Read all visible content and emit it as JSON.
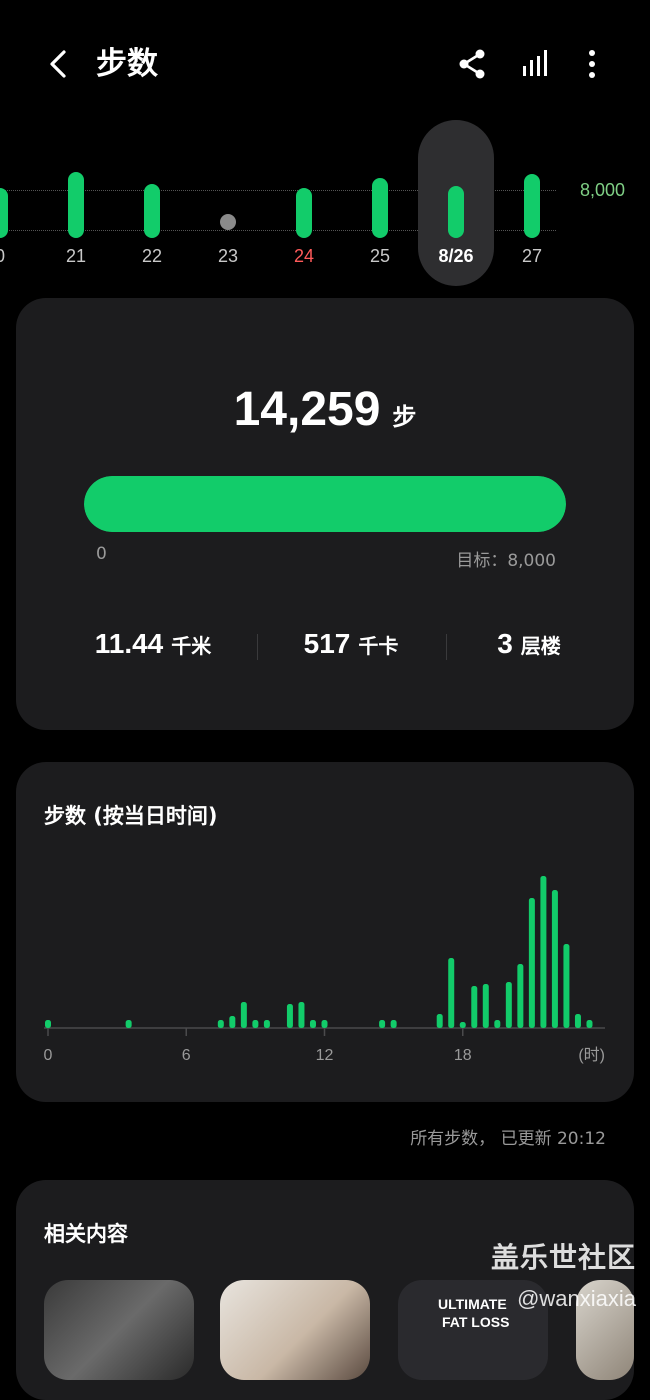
{
  "header": {
    "title": "步数",
    "icons": [
      "back-arrow-icon",
      "share-icon",
      "bar-chart-icon",
      "more-vertical-icon"
    ]
  },
  "daystrip": {
    "goal_label": "8,000",
    "days": [
      {
        "label": "0",
        "steps_fraction": 0.85,
        "state": "normal"
      },
      {
        "label": "21",
        "steps_fraction": 1.25,
        "state": "normal"
      },
      {
        "label": "22",
        "steps_fraction": 0.95,
        "state": "normal"
      },
      {
        "label": "23",
        "steps_fraction": 0,
        "state": "empty"
      },
      {
        "label": "24",
        "steps_fraction": 0.85,
        "state": "weekend"
      },
      {
        "label": "25",
        "steps_fraction": 1.1,
        "state": "normal"
      },
      {
        "label": "8/26",
        "steps_fraction": 0.9,
        "state": "selected"
      },
      {
        "label": "27",
        "steps_fraction": 1.2,
        "state": "normal"
      }
    ]
  },
  "summary": {
    "steps": "14,259",
    "steps_unit": "步",
    "progress_fraction": 1.0,
    "progress_min": "0",
    "goal_text": "目标：8,000",
    "stats": [
      {
        "value": "11.44",
        "unit": "千米"
      },
      {
        "value": "517",
        "unit": "千卡"
      },
      {
        "value": "3",
        "unit": "层楼"
      }
    ]
  },
  "hourly": {
    "title": "步数 (按当日时间)"
  },
  "chart_data": {
    "type": "bar",
    "title": "步数 (按当日时间)",
    "x_tick_labels": [
      "0",
      "6",
      "12",
      "18",
      "(时)"
    ],
    "x_ticks": [
      0,
      6,
      12,
      18
    ],
    "xlim": [
      0,
      24
    ],
    "unit": "(时)",
    "bars": [
      {
        "x": 0.0,
        "v": 8
      },
      {
        "x": 3.5,
        "v": 8
      },
      {
        "x": 7.5,
        "v": 8
      },
      {
        "x": 8.0,
        "v": 12
      },
      {
        "x": 8.5,
        "v": 26
      },
      {
        "x": 9.0,
        "v": 8
      },
      {
        "x": 9.5,
        "v": 8
      },
      {
        "x": 10.5,
        "v": 24
      },
      {
        "x": 11.0,
        "v": 26
      },
      {
        "x": 11.5,
        "v": 8
      },
      {
        "x": 12.0,
        "v": 8
      },
      {
        "x": 14.5,
        "v": 8
      },
      {
        "x": 15.0,
        "v": 8
      },
      {
        "x": 17.0,
        "v": 14
      },
      {
        "x": 17.5,
        "v": 70
      },
      {
        "x": 18.0,
        "v": 6
      },
      {
        "x": 18.5,
        "v": 42
      },
      {
        "x": 19.0,
        "v": 44
      },
      {
        "x": 19.5,
        "v": 8
      },
      {
        "x": 20.0,
        "v": 46
      },
      {
        "x": 20.5,
        "v": 64
      },
      {
        "x": 21.0,
        "v": 130
      },
      {
        "x": 21.5,
        "v": 152
      },
      {
        "x": 22.0,
        "v": 138
      },
      {
        "x": 22.5,
        "v": 84
      },
      {
        "x": 23.0,
        "v": 14
      },
      {
        "x": 23.5,
        "v": 8
      }
    ]
  },
  "update_text": "所有步数， 已更新 20:12",
  "related": {
    "title": "相关内容",
    "thumb_texts": [
      "ULTIMATE",
      "FAT LOSS"
    ]
  },
  "watermark": {
    "line1": "盖乐世社区",
    "line2": "@wanxiaxia"
  },
  "colors": {
    "accent": "#12cc6a",
    "background": "#000000",
    "card": "#1c1c1e",
    "weekend": "#ff5a5a",
    "goal": "#7fcf85"
  }
}
